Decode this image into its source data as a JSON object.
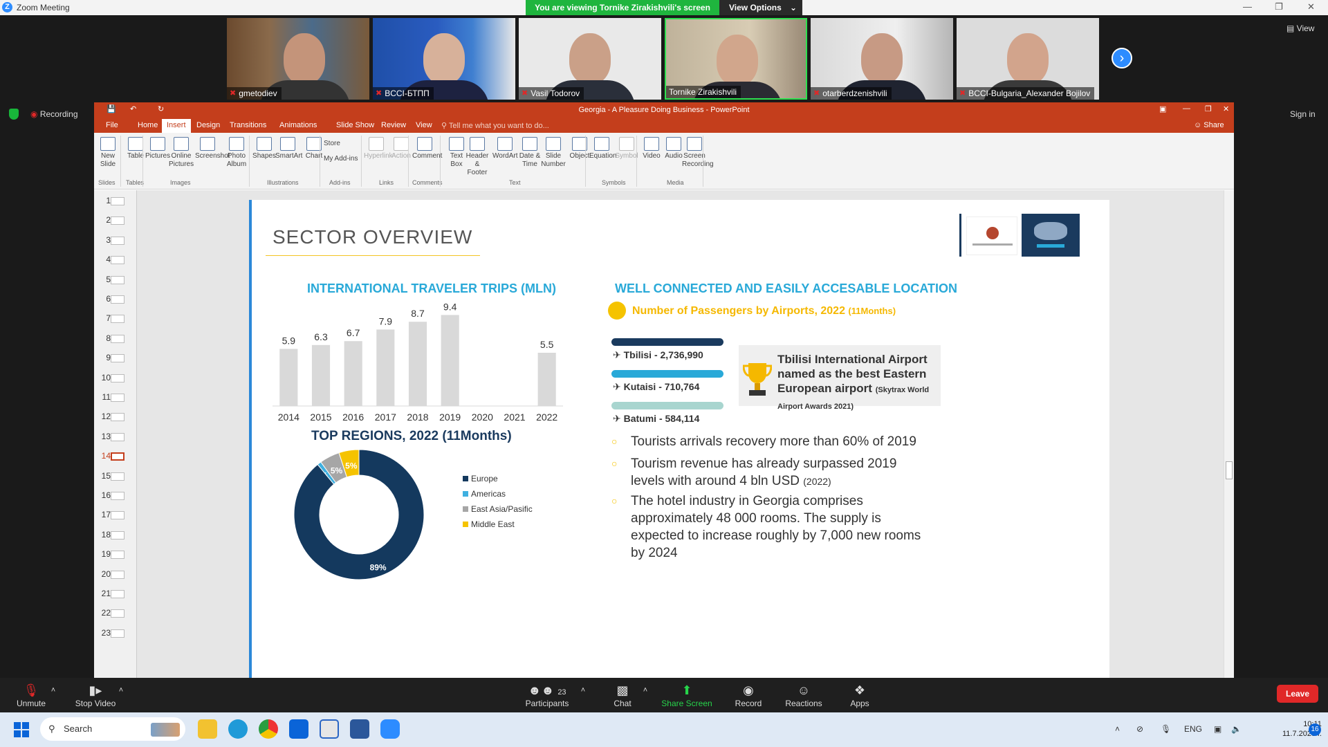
{
  "window": {
    "app_title": "Zoom Meeting"
  },
  "banner": {
    "viewing_text": "You are viewing Tornike Zirakishvili's screen",
    "view_options_label": "View Options"
  },
  "participants": [
    {
      "name": "gmetodiev"
    },
    {
      "name": "BCCI-БТПП"
    },
    {
      "name": "Vasil Todorov"
    },
    {
      "name": "Tornike Zirakishvili"
    },
    {
      "name": "otarberdzenishvili"
    },
    {
      "name": "BCCI-Bulgaria_Alexander Bojilov"
    }
  ],
  "gallery": {
    "view_label": "View"
  },
  "recording": {
    "label": "Recording"
  },
  "signin": {
    "label": "Sign in"
  },
  "ppt": {
    "title": "Georgia - A Pleasure Doing Business - PowerPoint",
    "tabs": [
      "File",
      "Home",
      "Insert",
      "Design",
      "Transitions",
      "Animations",
      "Slide Show",
      "Review",
      "View"
    ],
    "active_tab": "Insert",
    "tell_me": "Tell me what you want to do...",
    "share_label": "Share",
    "ribbon_buttons": [
      {
        "label": "New\nSlide"
      },
      {
        "label": "Table"
      },
      {
        "label": "Pictures"
      },
      {
        "label": "Online\nPictures"
      },
      {
        "label": "Screenshot"
      },
      {
        "label": "Photo\nAlbum"
      },
      {
        "label": "Shapes"
      },
      {
        "label": "SmartArt"
      },
      {
        "label": "Chart"
      },
      {
        "label": "Hyperlink"
      },
      {
        "label": "Action"
      },
      {
        "label": "Comment"
      },
      {
        "label": "Text\nBox"
      },
      {
        "label": "Header\n& Footer"
      },
      {
        "label": "WordArt"
      },
      {
        "label": "Date &\nTime"
      },
      {
        "label": "Slide\nNumber"
      },
      {
        "label": "Object"
      },
      {
        "label": "Equation"
      },
      {
        "label": "Symbol"
      },
      {
        "label": "Video"
      },
      {
        "label": "Audio"
      },
      {
        "label": "Screen\nRecording"
      }
    ],
    "addins": {
      "store": "Store",
      "my_addins": "My Add-ins"
    },
    "ribbon_groups": [
      "Slides",
      "Tables",
      "Images",
      "Illustrations",
      "Add-ins",
      "Links",
      "Comments",
      "Text",
      "Symbols",
      "Media"
    ],
    "slide_numbers": [
      "1",
      "2",
      "3",
      "4",
      "5",
      "6",
      "7",
      "8",
      "9",
      "10",
      "11",
      "12",
      "13",
      "14",
      "15",
      "16",
      "17",
      "18",
      "19",
      "20",
      "21",
      "22",
      "23"
    ],
    "current_slide": "14"
  },
  "slide": {
    "title": "SECTOR OVERVIEW",
    "left_chart_title": "INTERNATIONAL TRAVELER TRIPS (MLN)",
    "right_title": "WELL CONNECTED AND EASILY ACCESABLE LOCATION",
    "passengers_title": "Number of Passengers by Airports, 2022",
    "passengers_note": "(11Months)",
    "airports": [
      {
        "label": "Tbilisi  - 2,736,990",
        "value": 2736990,
        "color": "#1a3a5e"
      },
      {
        "label": "Kutaisi - 710,764",
        "value": 710764,
        "color": "#29a9d8"
      },
      {
        "label": "Batumi - 584,114",
        "value": 584114,
        "color": "#a8d5cf"
      }
    ],
    "award_main": "Tbilisi  International Airport named as the best Eastern European airport",
    "award_note": "(Skytrax World Airport Awards 2021)",
    "bullets": [
      {
        "text": "Tourists arrivals recovery more than 60% of 2019",
        "note": ""
      },
      {
        "text": "Tourism revenue has already surpassed 2019 levels with around 4 bln USD",
        "note": "(2022)"
      },
      {
        "text": "The hotel industry in Georgia comprises approximately 48 000 rooms. The supply is expected to increase roughly by 7,000 new rooms by 2024",
        "note": ""
      }
    ],
    "regions_title": "TOP REGIONS, 2022 (11Months)"
  },
  "chart_data": [
    {
      "type": "bar",
      "title": "INTERNATIONAL TRAVELER TRIPS (MLN)",
      "categories": [
        "2014",
        "2015",
        "2016",
        "2017",
        "2018",
        "2019",
        "2020",
        "2021",
        "2022"
      ],
      "values": [
        5.9,
        6.3,
        6.7,
        7.9,
        8.7,
        9.4,
        null,
        null,
        5.5
      ],
      "labels": [
        "5.9",
        "6.3",
        "6.7",
        "7.9",
        "8.7",
        "9.4",
        "",
        "",
        "5.5"
      ],
      "ylim": [
        0,
        10
      ],
      "color": "#d9d9d9"
    },
    {
      "type": "pie",
      "title": "TOP REGIONS, 2022 (11Months)",
      "donut": true,
      "slices": [
        {
          "name": "Europe",
          "value": 89,
          "label": "89%",
          "color": "#14395e"
        },
        {
          "name": "Americas",
          "value": 1,
          "label": "1%",
          "color": "#3fb0e0"
        },
        {
          "name": "East Asia/Pasific",
          "value": 5,
          "label": "5%",
          "color": "#a6a6a6"
        },
        {
          "name": "Middle East",
          "value": 5,
          "label": "5%",
          "color": "#f5c300"
        }
      ]
    }
  ],
  "toolbar": {
    "unmute": "Unmute",
    "stop_video": "Stop Video",
    "participants": "Participants",
    "participants_count": "23",
    "chat": "Chat",
    "share_screen": "Share Screen",
    "record": "Record",
    "reactions": "Reactions",
    "apps": "Apps",
    "leave": "Leave"
  },
  "taskbar": {
    "search": "Search",
    "lang": "ENG",
    "time": "10:11",
    "date": "11.7.2023 г.",
    "notif": "16"
  }
}
